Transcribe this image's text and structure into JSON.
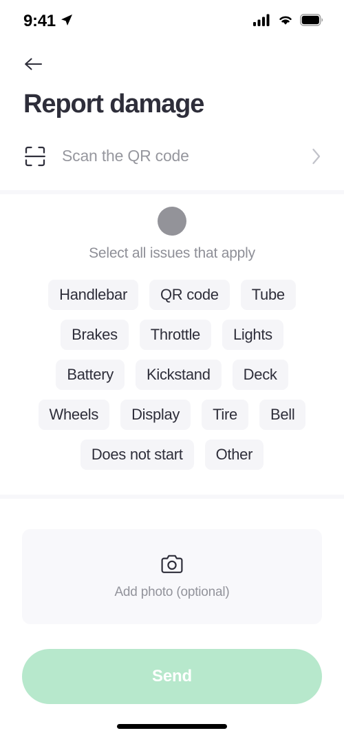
{
  "status_bar": {
    "time": "9:41",
    "location_icon": "location-arrow-icon",
    "signal_icon": "cellular-signal-icon",
    "wifi_icon": "wifi-icon",
    "battery_icon": "battery-full-icon"
  },
  "header": {
    "back_icon": "arrow-left-icon",
    "title": "Report damage"
  },
  "scan": {
    "icon": "qr-scan-icon",
    "label": "Scan the QR code",
    "chevron_icon": "chevron-right-icon"
  },
  "issues": {
    "hint": "Select all issues that apply",
    "avatar_icon": "scooter-avatar-circle",
    "rows": [
      [
        "Handlebar",
        "QR code",
        "Tube"
      ],
      [
        "Brakes",
        "Throttle",
        "Lights"
      ],
      [
        "Battery",
        "Kickstand",
        "Deck"
      ],
      [
        "Wheels",
        "Display",
        "Tire",
        "Bell"
      ],
      [
        "Does not start",
        "Other"
      ]
    ]
  },
  "photo": {
    "icon": "camera-icon",
    "label": "Add photo (optional)"
  },
  "submit": {
    "label": "Send"
  },
  "colors": {
    "accent_green": "#b7e8cc",
    "title_dark": "#2e2e3a",
    "muted_gray": "#92939b",
    "chip_bg": "#f5f5f8",
    "panel_bg": "#f8f8fb"
  }
}
